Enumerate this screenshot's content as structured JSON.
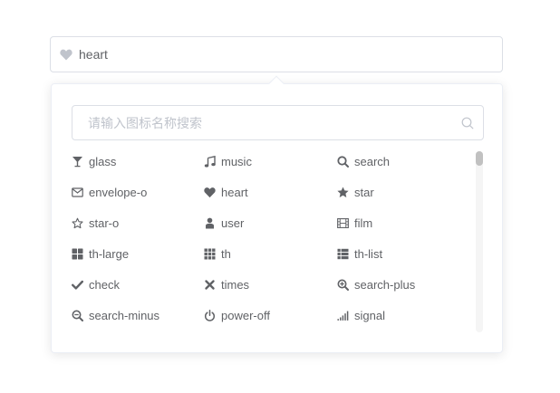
{
  "selected": {
    "icon": "heart-icon",
    "value": "heart"
  },
  "search": {
    "placeholder": "请输入图标名称搜索",
    "value": ""
  },
  "icons": [
    {
      "name": "glass",
      "icon": "glass-icon"
    },
    {
      "name": "music",
      "icon": "music-icon"
    },
    {
      "name": "search",
      "icon": "search-icon"
    },
    {
      "name": "envelope-o",
      "icon": "envelope-o-icon"
    },
    {
      "name": "heart",
      "icon": "heart-icon"
    },
    {
      "name": "star",
      "icon": "star-icon"
    },
    {
      "name": "star-o",
      "icon": "star-o-icon"
    },
    {
      "name": "user",
      "icon": "user-icon"
    },
    {
      "name": "film",
      "icon": "film-icon"
    },
    {
      "name": "th-large",
      "icon": "th-large-icon"
    },
    {
      "name": "th",
      "icon": "th-icon"
    },
    {
      "name": "th-list",
      "icon": "th-list-icon"
    },
    {
      "name": "check",
      "icon": "check-icon"
    },
    {
      "name": "times",
      "icon": "times-icon"
    },
    {
      "name": "search-plus",
      "icon": "search-plus-icon"
    },
    {
      "name": "search-minus",
      "icon": "search-minus-icon"
    },
    {
      "name": "power-off",
      "icon": "power-off-icon"
    },
    {
      "name": "signal",
      "icon": "signal-icon"
    }
  ],
  "colors": {
    "text": "#606266",
    "icon": "#606266",
    "selected_icon": "#c0c4cc",
    "placeholder": "#c0c4cc",
    "border": "#dcdfe6"
  }
}
